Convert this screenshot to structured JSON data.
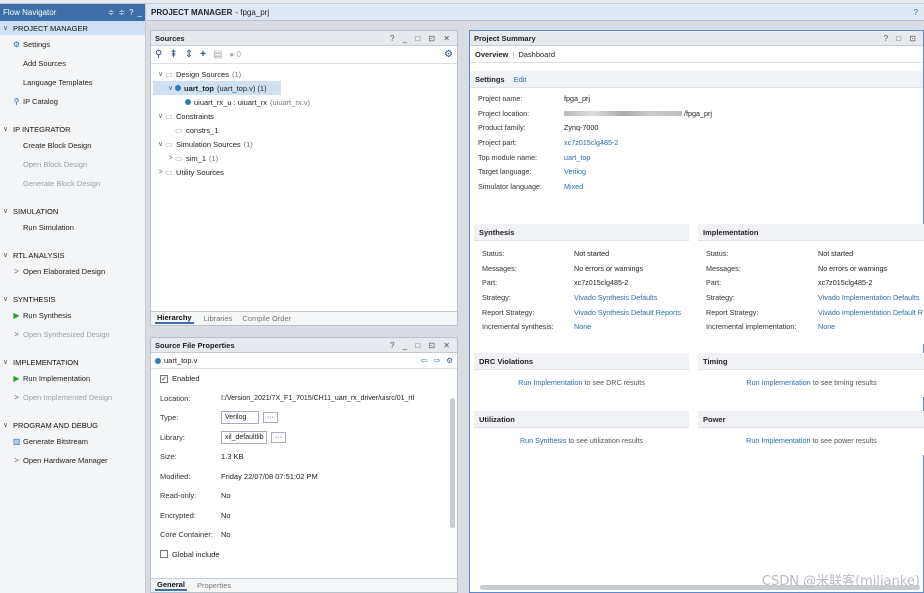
{
  "flow_navigator": {
    "title": "Flow Navigator",
    "header_icons": [
      "≑",
      "≑",
      "?",
      "_"
    ],
    "sections": [
      {
        "label": "PROJECT MANAGER",
        "selected": true,
        "items": [
          {
            "label": "Settings",
            "icon": "gear-icon",
            "dim": false
          },
          {
            "label": "Add Sources",
            "icon": "",
            "dim": false
          },
          {
            "label": "Language Templates",
            "icon": "",
            "dim": false
          },
          {
            "label": "IP Catalog",
            "icon": "ip-catalog-icon",
            "dim": false
          }
        ]
      },
      {
        "label": "IP INTEGRATOR",
        "selected": false,
        "items": [
          {
            "label": "Create Block Design",
            "icon": "",
            "dim": false
          },
          {
            "label": "Open Block Design",
            "icon": "",
            "dim": true
          },
          {
            "label": "Generate Block Design",
            "icon": "",
            "dim": true
          }
        ]
      },
      {
        "label": "SIMULATION",
        "selected": false,
        "items": [
          {
            "label": "Run Simulation",
            "icon": "",
            "dim": false
          }
        ]
      },
      {
        "label": "RTL ANALYSIS",
        "selected": false,
        "items": [
          {
            "label": "Open Elaborated Design",
            "icon": "expand-arrow-icon",
            "dim": false
          }
        ]
      },
      {
        "label": "SYNTHESIS",
        "selected": false,
        "items": [
          {
            "label": "Run Synthesis",
            "icon": "play-icon",
            "dim": false
          },
          {
            "label": "Open Synthesized Design",
            "icon": "expand-arrow-icon",
            "dim": true
          }
        ]
      },
      {
        "label": "IMPLEMENTATION",
        "selected": false,
        "items": [
          {
            "label": "Run Implementation",
            "icon": "play-icon",
            "dim": false
          },
          {
            "label": "Open Implemented Design",
            "icon": "expand-arrow-icon",
            "dim": true
          }
        ]
      },
      {
        "label": "PROGRAM AND DEBUG",
        "selected": false,
        "items": [
          {
            "label": "Generate Bitstream",
            "icon": "bitstream-icon",
            "dim": false
          },
          {
            "label": "Open Hardware Manager",
            "icon": "expand-arrow-icon",
            "dim": false
          }
        ]
      }
    ]
  },
  "title_bar": {
    "label": "PROJECT MANAGER",
    "project": "- fpga_prj",
    "help": "?"
  },
  "sources": {
    "title": "Sources",
    "controls": "? _ □ ⊡ ✕",
    "toolbar_count": "0",
    "tree": [
      {
        "label": "Design Sources",
        "count": "(1)",
        "level": 0,
        "expand": "∨"
      },
      {
        "label": "uart_top",
        "sub": "(uart_top.v) (1)",
        "level": 1,
        "expand": "∨",
        "selected": true
      },
      {
        "label": "uiuart_rx_u : uiuart_rx",
        "sub": "(uiuart_rx.v)",
        "level": 2,
        "expand": ""
      },
      {
        "label": "Constraints",
        "count": "",
        "level": 0,
        "expand": "∨"
      },
      {
        "label": "constrs_1",
        "count": "",
        "level": 1,
        "expand": ""
      },
      {
        "label": "Simulation Sources",
        "count": "(1)",
        "level": 0,
        "expand": "∨"
      },
      {
        "label": "sim_1",
        "count": "(1)",
        "level": 1,
        "expand": ">"
      },
      {
        "label": "Utility Sources",
        "count": "",
        "level": 0,
        "expand": ">"
      }
    ],
    "tabs": [
      "Hierarchy",
      "Libraries",
      "Compile Order"
    ]
  },
  "sfp": {
    "title": "Source File Properties",
    "controls": "? _ □ ⊡ ✕",
    "file": "uart_top.v",
    "enabled_label": "Enabled",
    "rows": {
      "location": {
        "k": "Location:",
        "v": "I:/Version_2021/7X_F1_7015/CH11_uart_rx_driver/uisrc/01_rtl"
      },
      "type": {
        "k": "Type:",
        "v": "Verilog"
      },
      "library": {
        "k": "Library:",
        "v": "xil_defaultlib"
      },
      "size": {
        "k": "Size:",
        "v": "1.3 KB"
      },
      "modified": {
        "k": "Modified:",
        "v": "Friday 22/07/08 07:51:02 PM"
      },
      "readonly": {
        "k": "Read-only:",
        "v": "No"
      },
      "encrypted": {
        "k": "Encrypted:",
        "v": "No"
      },
      "core": {
        "k": "Core Container:",
        "v": "No"
      }
    },
    "global_include": "Global include",
    "tabs": [
      "General",
      "Properties"
    ]
  },
  "summary": {
    "title": "Project Summary",
    "controls": "? □ ⊡",
    "tabs": [
      "Overview",
      "Dashboard"
    ],
    "settings": {
      "title": "Settings",
      "edit": "Edit",
      "rows": [
        {
          "k": "Project name:",
          "v": "fpga_prj",
          "link": false
        },
        {
          "k": "Project location:",
          "v": "/fpga_prj",
          "link": false
        },
        {
          "k": "Product family:",
          "v": "Zynq-7000",
          "link": false
        },
        {
          "k": "Project part:",
          "v": "xc7z015clg485-2",
          "link": true
        },
        {
          "k": "Top module name:",
          "v": "uart_top",
          "link": true
        },
        {
          "k": "Target language:",
          "v": "Verilog",
          "link": true
        },
        {
          "k": "Simulator language:",
          "v": "Mixed",
          "link": true
        }
      ]
    },
    "synthesis": {
      "title": "Synthesis",
      "rows": [
        {
          "k": "Status:",
          "v": "Not started",
          "link": false
        },
        {
          "k": "Messages:",
          "v": "No errors or warnings",
          "link": false
        },
        {
          "k": "Part:",
          "v": "xc7z015clg485-2",
          "link": false
        },
        {
          "k": "Strategy:",
          "v": "Vivado Synthesis Defaults",
          "link": true
        },
        {
          "k": "Report Strategy:",
          "v": "Vivado Synthesis Default Reports",
          "link": true
        },
        {
          "k": "Incremental synthesis:",
          "v": "None",
          "link": true
        }
      ]
    },
    "implementation": {
      "title": "Implementation",
      "rows": [
        {
          "k": "Status:",
          "v": "Not started",
          "link": false
        },
        {
          "k": "Messages:",
          "v": "No errors or warnings",
          "link": false
        },
        {
          "k": "Part:",
          "v": "xc7z015clg485-2",
          "link": false
        },
        {
          "k": "Strategy:",
          "v": "Vivado Implementation Defaults",
          "link": true
        },
        {
          "k": "Report Strategy:",
          "v": "Vivado Implementation Default R",
          "link": true
        },
        {
          "k": "Incremental implementation:",
          "v": "None",
          "link": true
        }
      ]
    },
    "drc": {
      "title": "DRC Violations",
      "link": "Run Implementation",
      "text": "to see DRC results"
    },
    "timing": {
      "title": "Timing",
      "link": "Run Implementation",
      "text": "to see timing results"
    },
    "utilization": {
      "title": "Utilization",
      "link": "Run Synthesis",
      "text": "to see utilization results"
    },
    "power": {
      "title": "Power",
      "link": "Run Implementation",
      "text": "to see power results"
    }
  },
  "watermark": "CSDN @米联客(milianke)"
}
